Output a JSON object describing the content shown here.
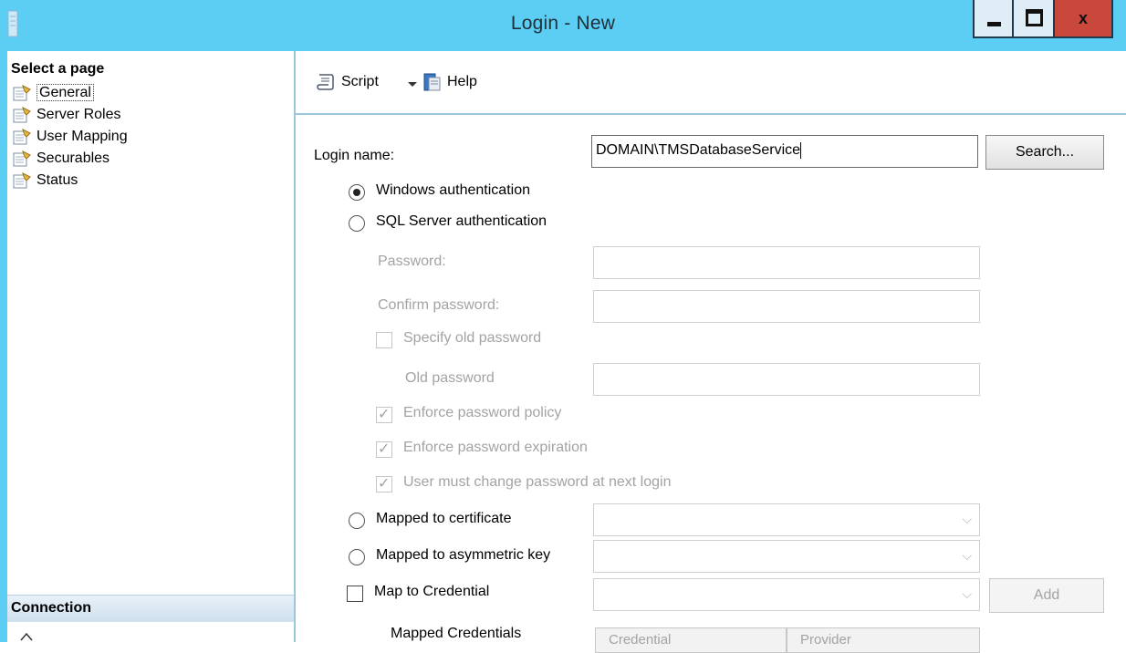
{
  "window": {
    "title": "Login - New",
    "close_glyph": "x"
  },
  "left_panel": {
    "select_header": "Select a page",
    "pages": [
      {
        "label": "General",
        "selected": true
      },
      {
        "label": "Server Roles",
        "selected": false
      },
      {
        "label": "User Mapping",
        "selected": false
      },
      {
        "label": "Securables",
        "selected": false
      },
      {
        "label": "Status",
        "selected": false
      }
    ],
    "connection_header": "Connection"
  },
  "toolbar": {
    "script_label": "Script",
    "help_label": "Help"
  },
  "form": {
    "login_name_label": "Login name:",
    "login_name_value": "DOMAIN\\TMSDatabaseService",
    "search_button": "Search...",
    "windows_auth_label": "Windows authentication",
    "windows_auth_selected": true,
    "sql_auth_label": "SQL Server authentication",
    "password_label": "Password:",
    "confirm_password_label": "Confirm password:",
    "specify_old_password_label": "Specify old password",
    "old_password_label": "Old password",
    "enforce_policy_label": "Enforce password policy",
    "enforce_expiration_label": "Enforce password expiration",
    "must_change_label": "User must change password at next login",
    "mapped_certificate_label": "Mapped to certificate",
    "mapped_asymmetric_label": "Mapped to asymmetric key",
    "map_credential_label": "Map to Credential",
    "add_button": "Add",
    "mapped_credentials_label": "Mapped Credentials",
    "credential_col": "Credential",
    "provider_col": "Provider"
  },
  "colors": {
    "titlebar": "#5ccdf3",
    "close_button": "#c9483b",
    "disabled_text": "#a3a3a3"
  }
}
